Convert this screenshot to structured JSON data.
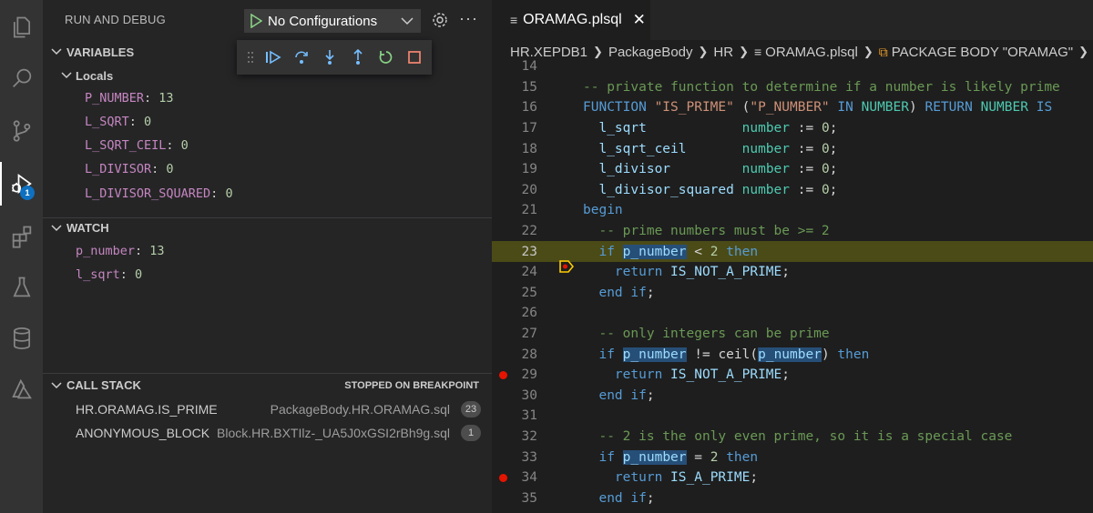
{
  "sidebar": {
    "title": "RUN AND DEBUG",
    "config": "No Configurations",
    "variables_header": "VARIABLES",
    "locals_header": "Locals",
    "locals": [
      {
        "name": "P_NUMBER",
        "value": "13"
      },
      {
        "name": "L_SQRT",
        "value": "0"
      },
      {
        "name": "L_SQRT_CEIL",
        "value": "0"
      },
      {
        "name": "L_DIVISOR",
        "value": "0"
      },
      {
        "name": "L_DIVISOR_SQUARED",
        "value": "0"
      }
    ],
    "watch_header": "WATCH",
    "watch": [
      {
        "name": "p_number",
        "value": "13"
      },
      {
        "name": "l_sqrt",
        "value": "0"
      }
    ],
    "callstack_header": "CALL STACK",
    "callstack_status": "STOPPED ON BREAKPOINT",
    "callstack": [
      {
        "fn": "HR.ORAMAG.IS_PRIME",
        "source": "PackageBody.HR.ORAMAG.sql",
        "line": "23"
      },
      {
        "fn": "ANONYMOUS_BLOCK",
        "source": "Block.HR.BXTIlz-_UA5J0xGSI2rBh9g.sql",
        "line": "1"
      }
    ]
  },
  "activity_bar": {
    "icons": [
      "explorer-icon",
      "search-icon",
      "source-control-icon",
      "run-debug-icon",
      "extensions-icon",
      "testing-icon",
      "database-icon",
      "azure-icon"
    ],
    "debug_badge": "1"
  },
  "editor": {
    "tab_label": "ORAMAG.plsql",
    "breadcrumb": [
      "HR.XEPDB1",
      "PackageBody",
      "HR",
      "ORAMAG.plsql",
      "PACKAGE BODY \"ORAMAG\""
    ],
    "line_numbers": [
      "14",
      "15",
      "16",
      "17",
      "18",
      "19",
      "20",
      "21",
      "22",
      "23",
      "24",
      "25",
      "26",
      "27",
      "28",
      "29",
      "30",
      "31",
      "32",
      "33",
      "34",
      "35"
    ],
    "current_line": "23",
    "breakpoints": [
      "23",
      "29",
      "34"
    ]
  },
  "colors": {
    "activity_bg": "#333333",
    "sidebar_bg": "#252526",
    "editor_bg": "#1e1e1e",
    "current_line_bg": "#4b4b18",
    "breakpoint": "#e51400",
    "badge": "#0e70c0"
  }
}
